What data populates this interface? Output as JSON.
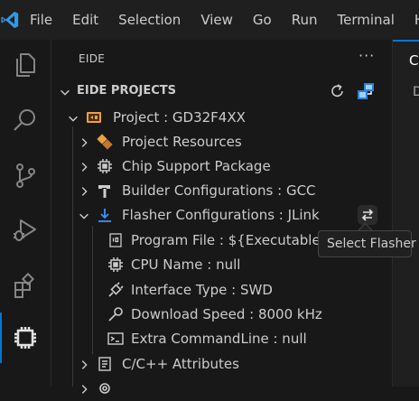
{
  "menubar": {
    "items": [
      "File",
      "Edit",
      "Selection",
      "View",
      "Go",
      "Run",
      "Terminal",
      "H"
    ]
  },
  "sidebar": {
    "title": "EIDE",
    "more_label": "···",
    "section_title": "EIDE PROJECTS",
    "rows": [
      {
        "label": "Project : GD32F4XX",
        "icon": "project-icon"
      },
      {
        "label": "Project Resources",
        "icon": "resources-icon"
      },
      {
        "label": "Chip Support Package",
        "icon": "chip-icon"
      },
      {
        "label": "Builder Configurations : GCC",
        "icon": "hammer-icon"
      },
      {
        "label": "Flasher Configurations : JLink",
        "icon": "download-arrow-icon"
      },
      {
        "label": "Program File : ${ExecutableN",
        "icon": "binary-file-icon"
      },
      {
        "label": "CPU Name : null",
        "icon": "cpu-icon"
      },
      {
        "label": "Interface Type : SWD",
        "icon": "plug-icon"
      },
      {
        "label": "Download Speed : 8000 kHz",
        "icon": "wrench-icon"
      },
      {
        "label": "Extra CommandLine : null",
        "icon": "terminal-icon"
      },
      {
        "label": "C/C++ Attributes",
        "icon": "attributes-icon"
      }
    ]
  },
  "editor": {
    "tab_letter": "C",
    "line_letter": "D"
  },
  "tooltip": {
    "text": "Select Flasher"
  },
  "colors": {
    "accent": "#0078d4",
    "background": "#181818",
    "text": "#cccccc"
  }
}
